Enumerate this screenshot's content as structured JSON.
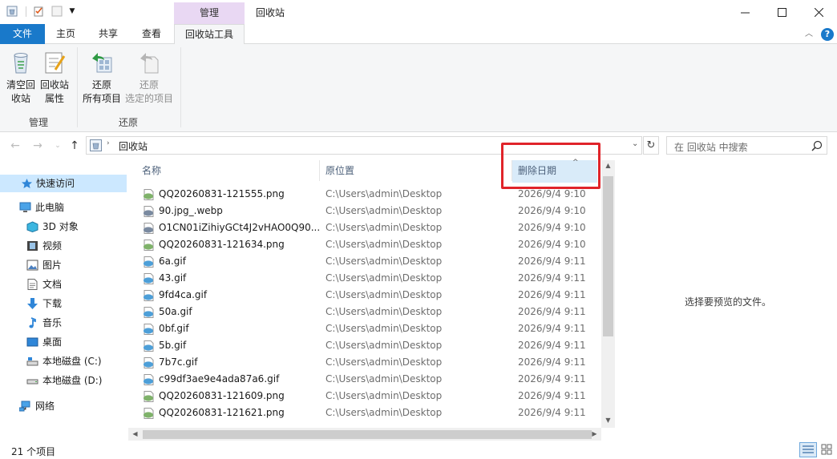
{
  "window": {
    "title": "回收站",
    "context_header": "管理"
  },
  "tabs": {
    "file": "文件",
    "home": "主页",
    "share": "共享",
    "view": "查看",
    "tools": "回收站工具"
  },
  "ribbon": {
    "empty_bin": "清空回\n收站",
    "empty_bin_l1": "清空回",
    "empty_bin_l2": "收站",
    "bin_props_l1": "回收站",
    "bin_props_l2": "属性",
    "restore_all_l1": "还原",
    "restore_all_l2": "所有项目",
    "restore_sel_l1": "还原",
    "restore_sel_l2": "选定的项目",
    "group_manage": "管理",
    "group_restore": "还原"
  },
  "address": {
    "path": "回收站",
    "search_placeholder": "在 回收站 中搜索"
  },
  "nav": {
    "quick_access": "快速访问",
    "this_pc": "此电脑",
    "objects3d": "3D 对象",
    "videos": "视频",
    "pictures": "图片",
    "documents": "文档",
    "downloads": "下载",
    "music": "音乐",
    "desktop": "桌面",
    "disk_c": "本地磁盘 (C:)",
    "disk_d": "本地磁盘 (D:)",
    "network": "网络"
  },
  "columns": {
    "name": "名称",
    "location": "原位置",
    "deleted": "删除日期"
  },
  "files": [
    {
      "name": "QQ20260831-121555.png",
      "loc": "C:\\Users\\admin\\Desktop",
      "date": "2026/9/4 9:10",
      "type": "png"
    },
    {
      "name": "90.jpg_.webp",
      "loc": "C:\\Users\\admin\\Desktop",
      "date": "2026/9/4 9:10",
      "type": "webp"
    },
    {
      "name": "O1CN01iZihiyGCt4J2vHAO0Q90...",
      "loc": "C:\\Users\\admin\\Desktop",
      "date": "2026/9/4 9:10",
      "type": "webp"
    },
    {
      "name": "QQ20260831-121634.png",
      "loc": "C:\\Users\\admin\\Desktop",
      "date": "2026/9/4 9:10",
      "type": "png"
    },
    {
      "name": "6a.gif",
      "loc": "C:\\Users\\admin\\Desktop",
      "date": "2026/9/4 9:11",
      "type": "gif"
    },
    {
      "name": "43.gif",
      "loc": "C:\\Users\\admin\\Desktop",
      "date": "2026/9/4 9:11",
      "type": "gif"
    },
    {
      "name": "9fd4ca.gif",
      "loc": "C:\\Users\\admin\\Desktop",
      "date": "2026/9/4 9:11",
      "type": "gif"
    },
    {
      "name": "50a.gif",
      "loc": "C:\\Users\\admin\\Desktop",
      "date": "2026/9/4 9:11",
      "type": "gif"
    },
    {
      "name": "0bf.gif",
      "loc": "C:\\Users\\admin\\Desktop",
      "date": "2026/9/4 9:11",
      "type": "gif"
    },
    {
      "name": "5b.gif",
      "loc": "C:\\Users\\admin\\Desktop",
      "date": "2026/9/4 9:11",
      "type": "gif"
    },
    {
      "name": "7b7c.gif",
      "loc": "C:\\Users\\admin\\Desktop",
      "date": "2026/9/4 9:11",
      "type": "gif"
    },
    {
      "name": "c99df3ae9e4ada87a6.gif",
      "loc": "C:\\Users\\admin\\Desktop",
      "date": "2026/9/4 9:11",
      "type": "gif"
    },
    {
      "name": "QQ20260831-121609.png",
      "loc": "C:\\Users\\admin\\Desktop",
      "date": "2026/9/4 9:11",
      "type": "png"
    },
    {
      "name": "QQ20260831-121621.png",
      "loc": "C:\\Users\\admin\\Desktop",
      "date": "2026/9/4 9:11",
      "type": "png"
    }
  ],
  "preview": {
    "empty_text": "选择要预览的文件。"
  },
  "status": {
    "count": "21 个项目"
  }
}
